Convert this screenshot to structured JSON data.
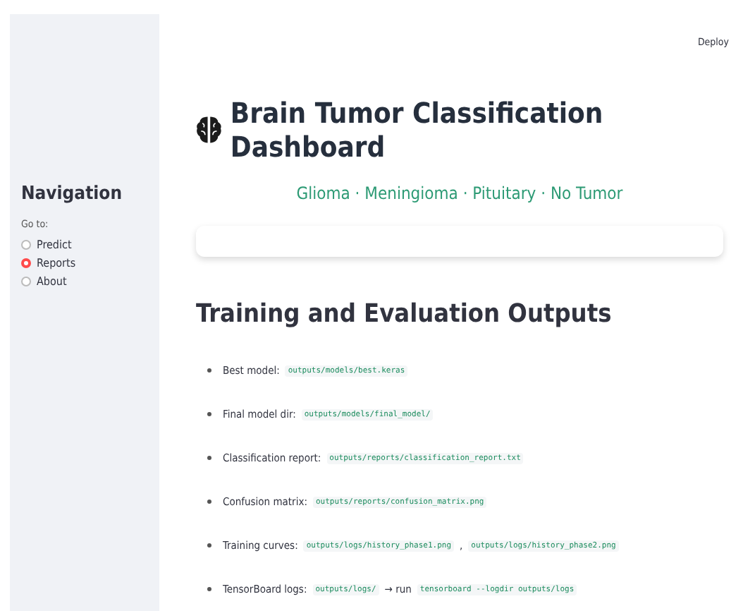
{
  "sidebar": {
    "title": "Navigation",
    "radio_label": "Go to:",
    "options": [
      {
        "label": "Predict",
        "selected": false
      },
      {
        "label": "Reports",
        "selected": true
      },
      {
        "label": "About",
        "selected": false
      }
    ]
  },
  "toolbar": {
    "deploy": "Deploy"
  },
  "header": {
    "title": "Brain Tumor Classification Dashboard",
    "subtitle": "Glioma · Meningioma · Pituitary · No Tumor"
  },
  "section": {
    "heading": "Training and Evaluation Outputs",
    "items": [
      [
        {
          "kind": "text",
          "text": "Best model:"
        },
        {
          "kind": "code",
          "text": "outputs/models/best.keras"
        }
      ],
      [
        {
          "kind": "text",
          "text": "Final model dir:"
        },
        {
          "kind": "code",
          "text": "outputs/models/final_model/"
        }
      ],
      [
        {
          "kind": "text",
          "text": "Classification report:"
        },
        {
          "kind": "code",
          "text": "outputs/reports/classification_report.txt"
        }
      ],
      [
        {
          "kind": "text",
          "text": "Confusion matrix:"
        },
        {
          "kind": "code",
          "text": "outputs/reports/confusion_matrix.png"
        }
      ],
      [
        {
          "kind": "text",
          "text": "Training curves:"
        },
        {
          "kind": "code",
          "text": "outputs/logs/history_phase1.png"
        },
        {
          "kind": "text",
          "text": ","
        },
        {
          "kind": "code",
          "text": "outputs/logs/history_phase2.png"
        }
      ],
      [
        {
          "kind": "text",
          "text": "TensorBoard logs:"
        },
        {
          "kind": "code",
          "text": "outputs/logs/"
        },
        {
          "kind": "text",
          "text": "→ run"
        },
        {
          "kind": "code",
          "text": "tensorboard --logdir outputs/logs"
        }
      ]
    ]
  }
}
